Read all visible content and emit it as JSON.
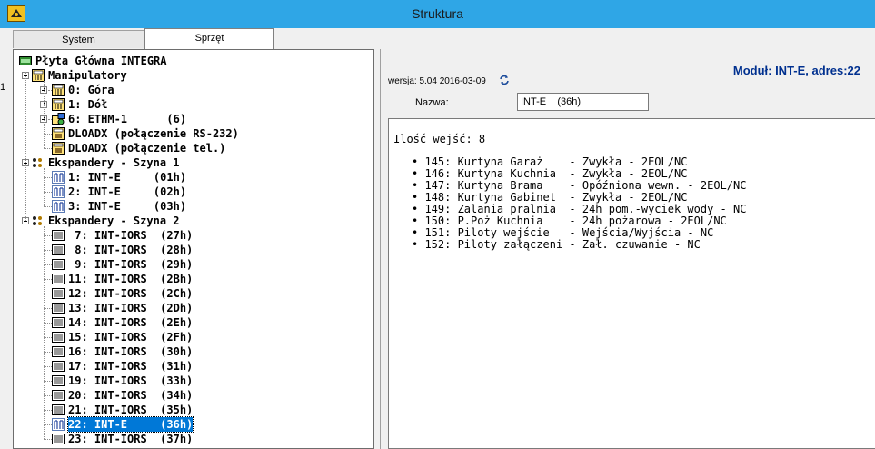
{
  "window": {
    "title": "Struktura",
    "left_edge_mark": "1"
  },
  "tabs": [
    {
      "label": "System"
    },
    {
      "label": "Sprzęt"
    }
  ],
  "tree": {
    "root": "Płyta Główna INTEGRA",
    "manipulatory": {
      "label": "Manipulatory",
      "items": [
        "0: Góra",
        "1: Dół",
        "6: ETHM-1      (6)",
        "DLOADX (połączenie RS-232)",
        "DLOADX (połączenie tel.)"
      ]
    },
    "bus1": {
      "label": "Ekspandery - Szyna 1",
      "items": [
        "1: INT-E     (01h)",
        "2: INT-E     (02h)",
        "3: INT-E     (03h)"
      ]
    },
    "bus2": {
      "label": "Ekspandery - Szyna 2",
      "items": [
        " 7: INT-IORS  (27h)",
        " 8: INT-IORS  (28h)",
        " 9: INT-IORS  (29h)",
        "11: INT-IORS  (2Bh)",
        "12: INT-IORS  (2Ch)",
        "13: INT-IORS  (2Dh)",
        "14: INT-IORS  (2Eh)",
        "15: INT-IORS  (2Fh)",
        "16: INT-IORS  (30h)",
        "17: INT-IORS  (31h)",
        "19: INT-IORS  (33h)",
        "20: INT-IORS  (34h)",
        "21: INT-IORS  (35h)",
        "22: INT-E     (36h)",
        "23: INT-IORS  (37h)"
      ],
      "selected_index": 13
    }
  },
  "details": {
    "module_title": "Moduł: INT-E, adres:22",
    "version": "wersja: 5.04 2016-03-09",
    "name_label": "Nazwa:",
    "name_value": "INT-E    (36h)",
    "inputs_count": "Ilość wejść: 8",
    "inputs": [
      "• 145: Kurtyna Garaż    - Zwykła - 2EOL/NC",
      "• 146: Kurtyna Kuchnia  - Zwykła - 2EOL/NC",
      "• 147: Kurtyna Brama    - Opóźniona wewn. - 2EOL/NC",
      "• 148: Kurtyna Gabinet  - Zwykła - 2EOL/NC",
      "• 149: Zalania pralnia  - 24h pom.-wyciek wody - NC",
      "• 150: P.Poż Kuchnia    - 24h pożarowa - 2EOL/NC",
      "• 151: Piloty wejście   - Wejścia/Wyjścia - NC",
      "• 152: Piloty załączeni - Zał. czuwanie - NC"
    ]
  },
  "colors": {
    "titlebar": "#2fa6e6",
    "module_title": "#00308f",
    "selection": "#0078d7"
  },
  "icons": {
    "board": "board-icon",
    "keypad": "keypad-icon",
    "ethm": "ethm-icon",
    "dloadx": "dloadx-icon",
    "bus": "bus-icon",
    "int_e": "int-e-icon",
    "int_iors": "int-iors-icon",
    "refresh": "refresh-icon"
  }
}
